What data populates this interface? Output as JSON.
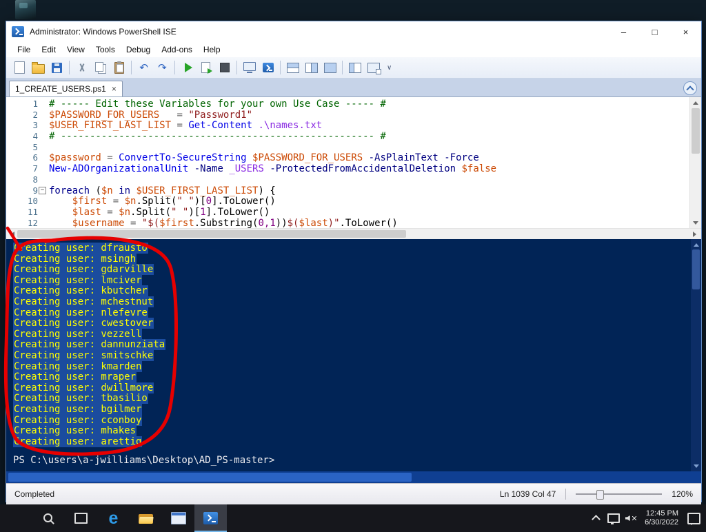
{
  "window": {
    "title": "Administrator: Windows PowerShell ISE",
    "controls": {
      "minimize": "–",
      "maximize": "□",
      "close": "×"
    }
  },
  "menu": {
    "items": [
      "File",
      "Edit",
      "View",
      "Tools",
      "Debug",
      "Add-ons",
      "Help"
    ]
  },
  "toolbar": {
    "groups": [
      [
        {
          "n": "new-script"
        },
        {
          "n": "open-script"
        },
        {
          "n": "save"
        }
      ],
      [
        {
          "n": "cut"
        },
        {
          "n": "copy"
        },
        {
          "n": "paste"
        }
      ],
      [
        {
          "n": "undo",
          "g": "↶"
        },
        {
          "n": "redo",
          "g": "↷"
        }
      ],
      [
        {
          "n": "run-script"
        },
        {
          "n": "run-selection"
        },
        {
          "n": "stop-operation"
        }
      ],
      [
        {
          "n": "new-remote-powershell-tab"
        },
        {
          "n": "start-powershell"
        }
      ],
      [
        {
          "n": "layout-script-top"
        },
        {
          "n": "layout-script-right"
        },
        {
          "n": "layout-script-max"
        }
      ],
      [
        {
          "n": "show-command-window"
        },
        {
          "n": "open-new-window"
        }
      ]
    ],
    "overflow_glyph": "∨"
  },
  "tab": {
    "label": "1_CREATE_USERS.ps1",
    "close_glyph": "×"
  },
  "editor": {
    "lines": [
      {
        "num": "1",
        "seg": [
          [
            "comment",
            "# ----- Edit these Variables for your own Use Case ----- #"
          ]
        ]
      },
      {
        "num": "2",
        "seg": [
          [
            "var",
            "$PASSWORD_FOR_USERS"
          ],
          [
            "op",
            "   = "
          ],
          [
            "str",
            "\"Password1\""
          ]
        ]
      },
      {
        "num": "3",
        "seg": [
          [
            "var",
            "$USER_FIRST_LAST_LIST"
          ],
          [
            "op",
            " = "
          ],
          [
            "cmdlet",
            "Get-Content"
          ],
          [
            "plain",
            " "
          ],
          [
            "arg",
            ".\\names.txt"
          ]
        ]
      },
      {
        "num": "4",
        "seg": [
          [
            "comment",
            "# ------------------------------------------------------ #"
          ]
        ]
      },
      {
        "num": "5",
        "seg": []
      },
      {
        "num": "6",
        "seg": [
          [
            "var",
            "$password"
          ],
          [
            "op",
            " = "
          ],
          [
            "cmdlet",
            "ConvertTo-SecureString"
          ],
          [
            "plain",
            " "
          ],
          [
            "var",
            "$PASSWORD_FOR_USERS"
          ],
          [
            "plain",
            " "
          ],
          [
            "param",
            "-AsPlainText"
          ],
          [
            "plain",
            " "
          ],
          [
            "param",
            "-Force"
          ]
        ]
      },
      {
        "num": "7",
        "seg": [
          [
            "cmdlet",
            "New-ADOrganizationalUnit"
          ],
          [
            "plain",
            " "
          ],
          [
            "param",
            "-Name"
          ],
          [
            "plain",
            " "
          ],
          [
            "arg",
            "_USERS"
          ],
          [
            "plain",
            " "
          ],
          [
            "param",
            "-ProtectedFromAccidentalDeletion"
          ],
          [
            "plain",
            " "
          ],
          [
            "var",
            "$false"
          ]
        ]
      },
      {
        "num": "8",
        "seg": []
      },
      {
        "num": "9",
        "seg": [
          [
            "fold",
            "−"
          ],
          [
            "kw",
            "foreach"
          ],
          [
            "plain",
            " ("
          ],
          [
            "var",
            "$n"
          ],
          [
            "plain",
            " "
          ],
          [
            "kw",
            "in"
          ],
          [
            "plain",
            " "
          ],
          [
            "var",
            "$USER_FIRST_LAST_LIST"
          ],
          [
            "plain",
            ") {"
          ]
        ]
      },
      {
        "num": "10",
        "seg": [
          [
            "plain",
            "    "
          ],
          [
            "var",
            "$first"
          ],
          [
            "op",
            " = "
          ],
          [
            "var",
            "$n"
          ],
          [
            "plain",
            ".Split("
          ],
          [
            "str",
            "\" \""
          ],
          [
            "plain",
            ")["
          ],
          [
            "num",
            "0"
          ],
          [
            "plain",
            "].ToLower()"
          ]
        ]
      },
      {
        "num": "11",
        "seg": [
          [
            "plain",
            "    "
          ],
          [
            "var",
            "$last"
          ],
          [
            "op",
            " = "
          ],
          [
            "var",
            "$n"
          ],
          [
            "plain",
            ".Split("
          ],
          [
            "str",
            "\" \""
          ],
          [
            "plain",
            ")["
          ],
          [
            "num",
            "1"
          ],
          [
            "plain",
            "].ToLower()"
          ]
        ]
      },
      {
        "num": "12",
        "seg": [
          [
            "plain",
            "    "
          ],
          [
            "var",
            "$username"
          ],
          [
            "op",
            " = "
          ],
          [
            "str",
            "\"$("
          ],
          [
            "var",
            "$first"
          ],
          [
            "plain",
            ".Substring("
          ],
          [
            "num",
            "0,1"
          ],
          [
            "plain",
            "))"
          ],
          [
            "str",
            "$("
          ],
          [
            "var",
            "$last"
          ],
          [
            "str",
            ")\""
          ],
          [
            "plain",
            ".ToLower()"
          ]
        ]
      }
    ]
  },
  "console": {
    "output_lines": [
      "Creating user: dfrausto",
      "Creating user: msingh",
      "Creating user: gdarville",
      "Creating user: lmciver",
      "Creating user: kbutcher",
      "Creating user: mchestnut",
      "Creating user: nlefevre",
      "Creating user: cwestover",
      "Creating user: vezzell",
      "Creating user: dannunziata",
      "Creating user: smitschke",
      "Creating user: kmarden",
      "Creating user: mraper",
      "Creating user: dwillmore",
      "Creating user: tbasilio",
      "Creating user: bgilmer",
      "Creating user: cconboy",
      "Creating user: mhakes",
      "Creating user: arettig"
    ],
    "prompt": "PS C:\\users\\a-jwilliams\\Desktop\\AD_PS-master>"
  },
  "status": {
    "completed": "Completed",
    "position": "Ln 1039 Col 47",
    "zoom": "120%"
  },
  "taskbar": {
    "time": "12:45 PM",
    "date": "6/30/2022",
    "apps": [
      {
        "n": "start"
      },
      {
        "n": "search"
      },
      {
        "n": "task-view"
      },
      {
        "n": "edge",
        "g": "e"
      },
      {
        "n": "file-explorer"
      },
      {
        "n": "app-window"
      },
      {
        "n": "powershell-ise",
        "active": true
      }
    ],
    "tray": [
      {
        "n": "hidden-icons-chevron"
      },
      {
        "n": "display"
      },
      {
        "n": "volume"
      }
    ]
  },
  "colors": {
    "console_background": "#012456",
    "console_output_text": "#ffff00",
    "annotation": "#e60000"
  }
}
